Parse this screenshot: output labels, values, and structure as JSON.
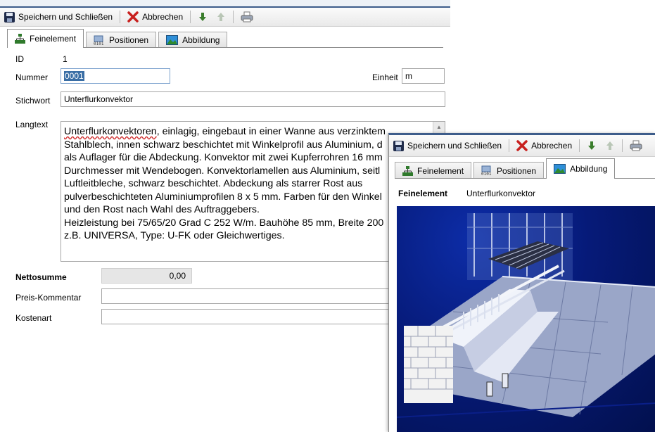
{
  "main_window": {
    "toolbar": {
      "save_close": "Speichern und Schließen",
      "cancel": "Abbrechen"
    },
    "tabs": [
      "Feinelement",
      "Positionen",
      "Abbildung"
    ],
    "active_tab": "Feinelement",
    "form": {
      "id_label": "ID",
      "id_value": "1",
      "nummer_label": "Nummer",
      "nummer_value": "0001",
      "einheit_label": "Einheit",
      "einheit_value": "m",
      "stichwort_label": "Stichwort",
      "stichwort_value": "Unterflurkonvektor",
      "langtext_label": "Langtext",
      "langtext_lines": [
        "Unterflurkonvektoren, einlagig, eingebaut in einer Wanne aus verzinktem",
        "Stahlblech, innen schwarz beschichtet mit Winkelprofil aus Aluminium, d",
        "als Auflager für die Abdeckung. Konvektor mit zwei Kupferrohren 16 mm",
        "Durchmesser mit Wendebogen. Konvektorlamellen aus Aluminium, seitl",
        "Luftleitbleche, schwarz beschichtet. Abdeckung als starrer Rost aus",
        "pulverbeschichteten Aluminiumprofilen 8 x 5 mm. Farben für den Winkel",
        "und den Rost nach Wahl des Auftraggebers.",
        "Heizleistung bei 75/65/20 Grad C 252 W/m. Bauhöhe 85 mm, Breite 200",
        "z.B. UNIVERSA, Type: U-FK oder Gleichwertiges."
      ],
      "nettosumme_label": "Nettosumme",
      "nettosumme_value": "0,00",
      "preis_kommentar_label": "Preis-Kommentar",
      "preis_kommentar_value": "",
      "kostenart_label": "Kostenart",
      "kostenart_value": ""
    }
  },
  "overlay_window": {
    "toolbar": {
      "save_close": "Speichern und Schließen",
      "cancel": "Abbrechen"
    },
    "tabs": [
      "Feinelement",
      "Positionen",
      "Abbildung"
    ],
    "active_tab": "Abbildung",
    "feinelement_label": "Feinelement",
    "feinelement_value": "Unterflurkonvektor"
  },
  "icons": [
    "save-icon",
    "cancel-x-icon",
    "arrow-down-icon",
    "arrow-up-icon",
    "print-icon",
    "structure-icon",
    "positions-icon",
    "image-icon"
  ],
  "colors": {
    "title_border": "#3d5c8a",
    "selection": "#3a6ea5",
    "cancel_red": "#c8201e",
    "arrow_green": "#3a7d2c",
    "image_bg": "#061a78"
  }
}
